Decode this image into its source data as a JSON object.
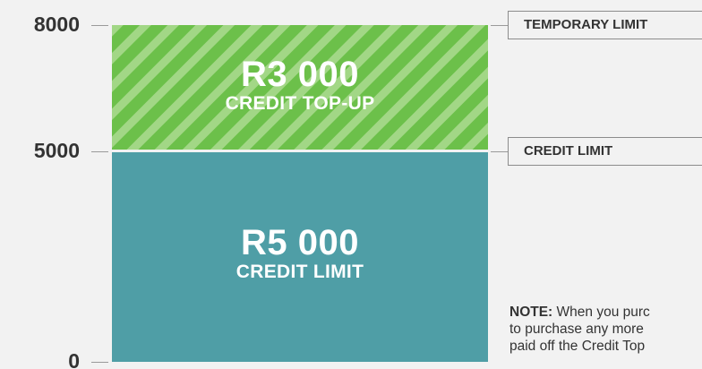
{
  "chart_data": {
    "type": "bar",
    "ylim": [
      0,
      8000
    ],
    "yticks": [
      8000,
      5000,
      0
    ],
    "tick_labels": [
      "8000",
      "5000",
      "0"
    ],
    "series": [
      {
        "values": [
          5000
        ],
        "amount_label": "R5 000",
        "caption": "CREDIT LIMIT",
        "color": "#4f9ea6",
        "pattern": "solid"
      },
      {
        "values": [
          3000
        ],
        "amount_label": "R3 000",
        "caption": "CREDIT TOP-UP",
        "color": "#6cc04a",
        "stripe_color": "#a2d786",
        "pattern": "diagonal-stripes"
      }
    ],
    "annotations": [
      {
        "label": "TEMPORARY LIMIT",
        "at": 8000
      },
      {
        "label": "CREDIT LIMIT",
        "at": 5000
      }
    ]
  },
  "note": {
    "prefix": "NOTE:",
    "lines": [
      " When you purc",
      "to purchase any more",
      "paid off the Credit Top"
    ]
  }
}
